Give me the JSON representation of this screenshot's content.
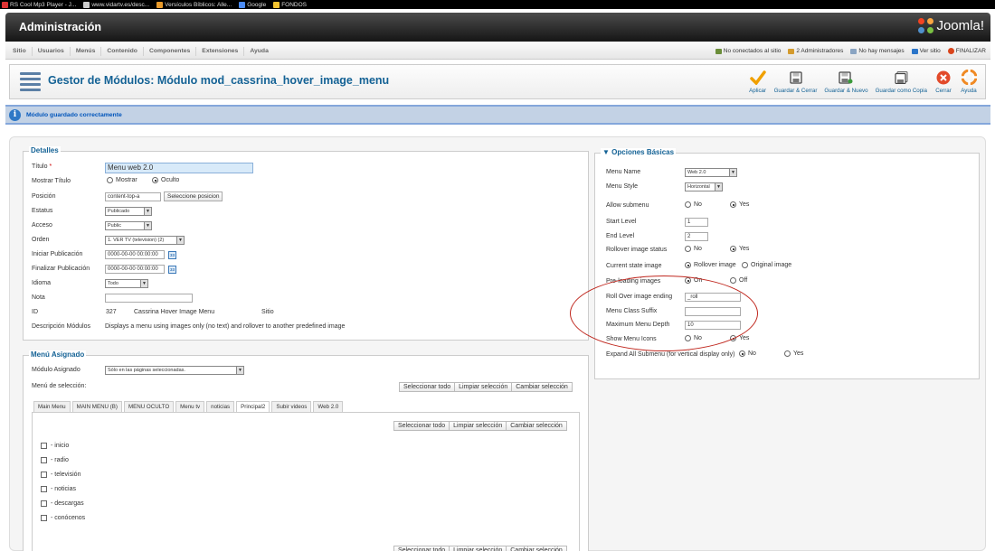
{
  "bookmarks": [
    {
      "label": "RS Cool Mp3 Player - J...",
      "color": "#d33"
    },
    {
      "label": "www.vidartv.es/desc...",
      "color": "#ccc"
    },
    {
      "label": "Versículos Bíblicos: Alle...",
      "color": "#e89a2b"
    },
    {
      "label": "Google",
      "color": "#4b8bf5"
    },
    {
      "label": "FONDOS",
      "color": "#f2c230"
    }
  ],
  "header": {
    "title": "Administración",
    "logo": "Joomla!"
  },
  "menu": {
    "items": [
      "Sitio",
      "Usuarios",
      "Menús",
      "Contenido",
      "Componentes",
      "Extensiones",
      "Ayuda"
    ],
    "status": {
      "visitors": "No conectados al sitio",
      "admins": "2 Administradores",
      "messages": "No hay mensajes",
      "view_site": "Ver sitio",
      "logout": "FINALIZAR"
    }
  },
  "toolbar": {
    "title": "Gestor de Módulos: Módulo mod_cassrina_hover_image_menu",
    "buttons": [
      {
        "label": "Aplicar",
        "icon": "check-icon"
      },
      {
        "label": "Guardar & Cerrar",
        "icon": "save-close-icon"
      },
      {
        "label": "Guardar & Nuevo",
        "icon": "save-new-icon"
      },
      {
        "label": "Guardar como Copia",
        "icon": "save-copy-icon"
      },
      {
        "label": "Cerrar",
        "icon": "cancel-icon"
      },
      {
        "label": "Ayuda",
        "icon": "help-icon"
      }
    ]
  },
  "message": "Módulo guardado correctamente",
  "details": {
    "legend": "Detalles",
    "title_label": "Título",
    "title_value": "Menu web 2.0",
    "show_title_label": "Mostrar Título",
    "show_title_opt1": "Mostrar",
    "show_title_opt2": "Oculto",
    "position_label": "Posición",
    "position_value": "content-top-a",
    "position_button": "Seleccione posicion",
    "status_label": "Estatus",
    "status_value": "Publicado",
    "access_label": "Acceso",
    "access_value": "Public",
    "order_label": "Orden",
    "order_value": "1. VER TV (television) (2)",
    "start_pub_label": "Iniciar Publicación",
    "start_pub_value": "0000-00-00 00:00:00",
    "end_pub_label": "Finalizar Publicación",
    "end_pub_value": "0000-00-00 00:00:00",
    "language_label": "Idioma",
    "language_value": "Todo",
    "note_label": "Nota",
    "note_value": "",
    "id_label": "ID",
    "id_value": "327",
    "id_name": "Cassrina Hover Image Menu",
    "id_site": "Sitio",
    "desc_label": "Descripción Módulos",
    "desc_value": "Displays a menu using images only (no text) and rollover to another predefined image",
    "calendar_icon_text": "33"
  },
  "assignment": {
    "legend": "Menú Asignado",
    "module_label": "Módulo Asignado",
    "module_value": "Sólo en las páginas seleccionadas.",
    "selection_label": "Menú de selección:",
    "btn_select_all": "Seleccionar todo",
    "btn_clear": "Limpiar selección",
    "btn_toggle": "Cambiar selección",
    "tabs": [
      "Main Menu",
      "MAIN MENU (B)",
      "MENU OCULTO",
      "Menu tv",
      "noticias",
      "Principal2",
      "Subir videos",
      "Web 2.0"
    ],
    "active_tab": "Principal2",
    "items": [
      "- inicio",
      "- radio",
      "- televisión",
      "- noticias",
      "- descargas",
      "- conócenos"
    ]
  },
  "basic_options": {
    "legend": "Opciones Básicas",
    "menu_name_label": "Menu Name",
    "menu_name_value": "Web 2.0",
    "menu_style_label": "Menu Style",
    "menu_style_value": "Horizontal",
    "allow_submenu_label": "Allow submenu",
    "no": "No",
    "yes": "Yes",
    "start_level_label": "Start Level",
    "start_level_value": "1",
    "end_level_label": "End Level",
    "end_level_value": "2",
    "rollover_status_label": "Rollover image status",
    "current_state_label": "Current state image",
    "current_state_opt1": "Rollover image",
    "current_state_opt2": "Original image",
    "preloading_label": "Pre-loading images",
    "on": "On",
    "off": "Off",
    "rollover_ending_label": "Roll Over image ending",
    "rollover_ending_value": "_roll",
    "menu_class_suffix_label": "Menu Class Suffix",
    "menu_class_suffix_value": "",
    "max_depth_label": "Maximum Menu Depth",
    "max_depth_value": "10",
    "show_icons_label": "Show Menu Icons",
    "expand_all_label": "Expand All Submenu (for vertical display only)"
  },
  "colors": {
    "accent": "#146295",
    "annotation": "#c0281f",
    "message_bg": "#c3d2e5"
  }
}
